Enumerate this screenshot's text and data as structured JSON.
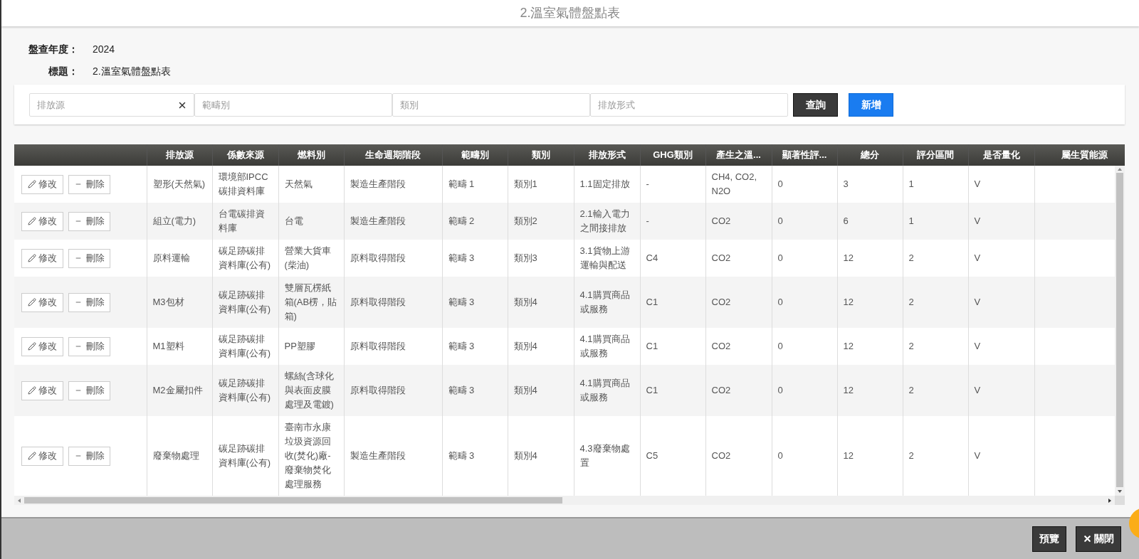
{
  "window": {
    "title": "2.溫室氣體盤點表"
  },
  "info": [
    {
      "label": "盤查年度：",
      "value": "2024"
    },
    {
      "label": "標題：",
      "value": "2.溫室氣體盤點表"
    }
  ],
  "filters": [
    {
      "placeholder": "排放源",
      "clearable": true
    },
    {
      "placeholder": "範疇別",
      "clearable": false
    },
    {
      "placeholder": "類別",
      "clearable": false
    },
    {
      "placeholder": "排放形式",
      "clearable": false
    }
  ],
  "filter_buttons": [
    {
      "label": "查詢",
      "kind": "dark"
    },
    {
      "label": "新增",
      "kind": "primary"
    }
  ],
  "table": {
    "columns": [
      "排放源",
      "係數來源",
      "燃料別",
      "生命週期階段",
      "範疇別",
      "類別",
      "排放形式",
      "GHG類別",
      "產生之溫...",
      "顯著性評...",
      "總分",
      "評分區間",
      "是否量化",
      "屬生質能源"
    ],
    "rows": [
      {
        "edit": "修改",
        "delete": "刪除",
        "cells": [
          "塑形(天然氣)",
          "環境部IPCC碳排資料庫",
          "天然氣",
          "製造生產階段",
          "範疇 1",
          "類別1",
          "1.1固定排放",
          "-",
          "CH4, CO2, N2O",
          "0",
          "3",
          "1",
          "V"
        ]
      },
      {
        "edit": "修改",
        "delete": "刪除",
        "cells": [
          "組立(電力)",
          "台電碳排資料庫",
          "台電",
          "製造生產階段",
          "範疇 2",
          "類別2",
          "2.1輸入電力之間接排放",
          "-",
          "CO2",
          "0",
          "6",
          "1",
          "V"
        ]
      },
      {
        "edit": "修改",
        "delete": "刪除",
        "cells": [
          "原料運輸",
          "碳足跡碳排資料庫(公有)",
          "營業大貨車(柴油)",
          "原料取得階段",
          "範疇 3",
          "類別3",
          "3.1貨物上游運輸與配送",
          "C4",
          "CO2",
          "0",
          "12",
          "2",
          "V"
        ]
      },
      {
        "edit": "修改",
        "delete": "刪除",
        "cells": [
          "M3包材",
          "碳足跡碳排資料庫(公有)",
          "雙層瓦楞紙箱(AB楞，貼箱)",
          "原料取得階段",
          "範疇 3",
          "類別4",
          "4.1購買商品或服務",
          "C1",
          "CO2",
          "0",
          "12",
          "2",
          "V"
        ]
      },
      {
        "edit": "修改",
        "delete": "刪除",
        "cells": [
          "M1塑料",
          "碳足跡碳排資料庫(公有)",
          "PP塑膠",
          "原料取得階段",
          "範疇 3",
          "類別4",
          "4.1購買商品或服務",
          "C1",
          "CO2",
          "0",
          "12",
          "2",
          "V"
        ]
      },
      {
        "edit": "修改",
        "delete": "刪除",
        "cells": [
          "M2金屬扣件",
          "碳足跡碳排資料庫(公有)",
          "螺絲(含球化與表面皮膜處理及電鍍)",
          "原料取得階段",
          "範疇 3",
          "類別4",
          "4.1購買商品或服務",
          "C1",
          "CO2",
          "0",
          "12",
          "2",
          "V"
        ]
      },
      {
        "edit": "修改",
        "delete": "刪除",
        "cells": [
          "廢棄物處理",
          "碳足跡碳排資料庫(公有)",
          "臺南市永康垃圾資源回收(焚化)廠-廢棄物焚化處理服務",
          "製造生產階段",
          "範疇 3",
          "類別4",
          "4.3廢棄物處置",
          "C5",
          "CO2",
          "0",
          "12",
          "2",
          "V"
        ]
      }
    ]
  },
  "footer_buttons": [
    {
      "label": "預覽",
      "kind": "plain"
    },
    {
      "label": "關閉",
      "kind": "close"
    }
  ]
}
